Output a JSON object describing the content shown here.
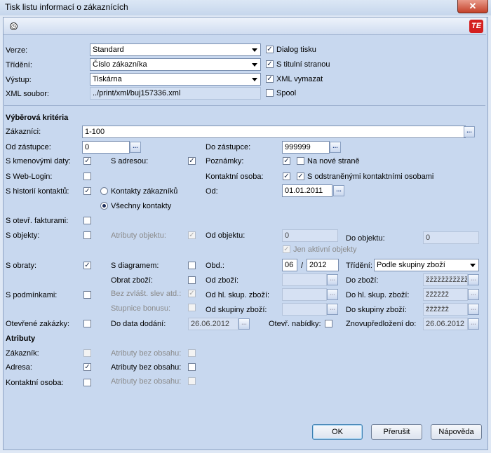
{
  "window": {
    "title": "Tisk listu informací o zákaznících",
    "close": "✕"
  },
  "toolbar": {
    "clock_icon": "clock-icon",
    "logo_text": "TE"
  },
  "top": {
    "verze_label": "Verze:",
    "verze_value": "Standard",
    "trideni_label": "Třídění:",
    "trideni_value": "Číslo zákazníka",
    "vystup_label": "Výstup:",
    "vystup_value": "Tiskárna",
    "xml_label": "XML soubor:",
    "xml_value": "../print/xml/buj157336.xml",
    "dialog_tisku": "Dialog tisku",
    "titulni": "S titulní stranou",
    "xml_vymazat": "XML vymazat",
    "spool": "Spool"
  },
  "criteria": {
    "heading": "Výběrová kritéria",
    "zakaznici_label": "Zákazníci:",
    "zakaznici_value": "1-100",
    "od_zastupce_label": "Od zástupce:",
    "od_zastupce_value": "0",
    "do_zastupce_label": "Do zástupce:",
    "do_zastupce_value": "999999",
    "kmenove": "S kmenovými daty:",
    "adresou": "S adresou:",
    "poznamky": "Poznámky:",
    "nove_strane": "Na nové straně",
    "weblogin": "S Web-Login:",
    "kontaktni_osoba": "Kontaktní osoba:",
    "odstranene": "S odstraněnými kontaktními osobami",
    "historie": "S historií kontaktů:",
    "kontakty_zakazniku": "Kontakty zákazníků",
    "vsechny_kontakty": "Všechny kontakty",
    "od_label": "Od:",
    "od_value": "01.01.2011",
    "fakturami": "S otevř. fakturami:",
    "objekty": "S objekty:",
    "atributy_objektu": "Atributy objektu:",
    "od_objektu": "Od objektu:",
    "od_objektu_value": "0",
    "do_objektu": "Do objektu:",
    "do_objektu_value": "0",
    "jen_aktivni": "Jen aktivní objekty",
    "obraty": "S obraty:",
    "diagramem": "S diagramem:",
    "obd": "Obd.:",
    "obd_month": "06",
    "obd_slash": "/",
    "obd_year": "2012",
    "trideni2": "Třídění:",
    "trideni2_value": "Podle skupiny zboží",
    "obrat_zbozi": "Obrat zboží:",
    "od_zbozi": "Od zboží:",
    "do_zbozi": "Do zboží:",
    "do_zbozi_value": "žžžžžžžžžžžž",
    "podminkami": "S podmínkami:",
    "bez_zvlast": "Bez zvlášt. slev atd.:",
    "od_hl": "Od hl. skup. zboží:",
    "do_hl": "Do hl. skup. zboží:",
    "do_hl_value": "žžžžžž",
    "stupnice": "Stupnice bonusu:",
    "od_skup": "Od skupiny zboží:",
    "do_skup": "Do skupiny zboží:",
    "do_skup_value": "žžžžžž",
    "otevrene": "Otevřené zakázky:",
    "do_data": "Do data dodání:",
    "do_data_value": "26.06.2012",
    "otevr_nabidky": "Otevř. nabídky:",
    "znovu": "Znovupředložení do:",
    "znovu_value": "26.06.2012"
  },
  "attributes": {
    "heading": "Atributy",
    "zakaznik": "Zákazník:",
    "adresa": "Adresa:",
    "kontaktni": "Kontaktní osoba:",
    "bez_obsahu": "Atributy bez obsahu:"
  },
  "buttons": {
    "ok": "OK",
    "prerusit": "Přerušit",
    "napoveda": "Nápověda"
  },
  "symbols": {
    "check": "✓",
    "dots": "..."
  }
}
